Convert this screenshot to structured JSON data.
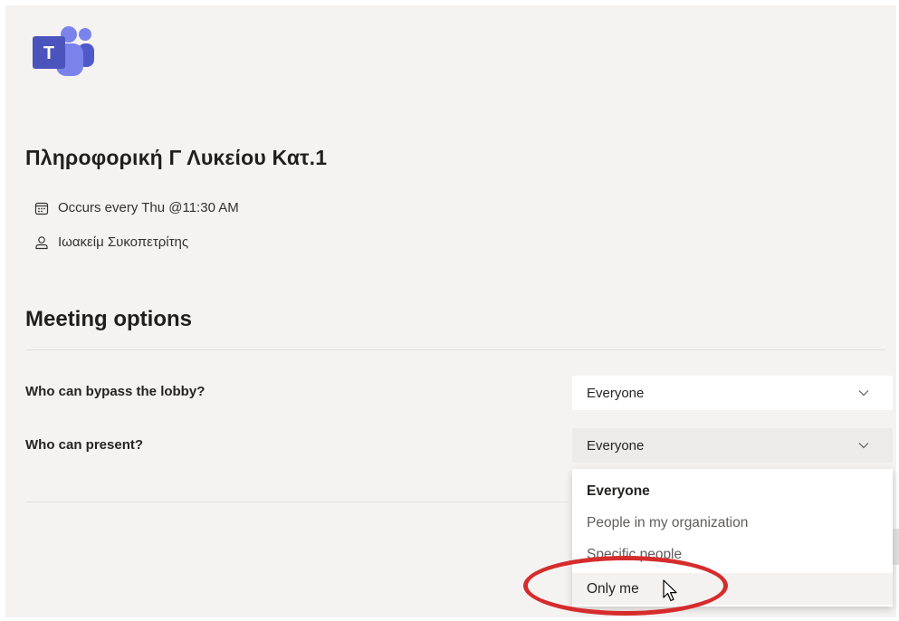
{
  "app": {
    "logo_icon": "microsoft-teams-logo-icon",
    "accent_color": "#5b5fc7"
  },
  "meeting": {
    "title": "Πληροφορική Γ Λυκείου Κατ.1",
    "recurrence": "Occurs every Thu @11:30 AM",
    "organizer": "Ιωακείμ Συκοπετρίτης",
    "recurrence_icon": "calendar-icon",
    "organizer_icon": "person-icon"
  },
  "options": {
    "section_title": "Meeting options",
    "bypass_lobby": {
      "label": "Who can bypass the lobby?",
      "value": "Everyone"
    },
    "who_can_present": {
      "label": "Who can present?",
      "value": "Everyone",
      "expanded": true,
      "menu": [
        {
          "label": "Everyone",
          "selected": true
        },
        {
          "label": "People in my organization"
        },
        {
          "label": "Specific people"
        },
        {
          "label": "Only me",
          "hovered": true
        }
      ]
    }
  },
  "annotation": {
    "highlight_color": "#d62c2c",
    "highlighted_item": "Only me"
  }
}
